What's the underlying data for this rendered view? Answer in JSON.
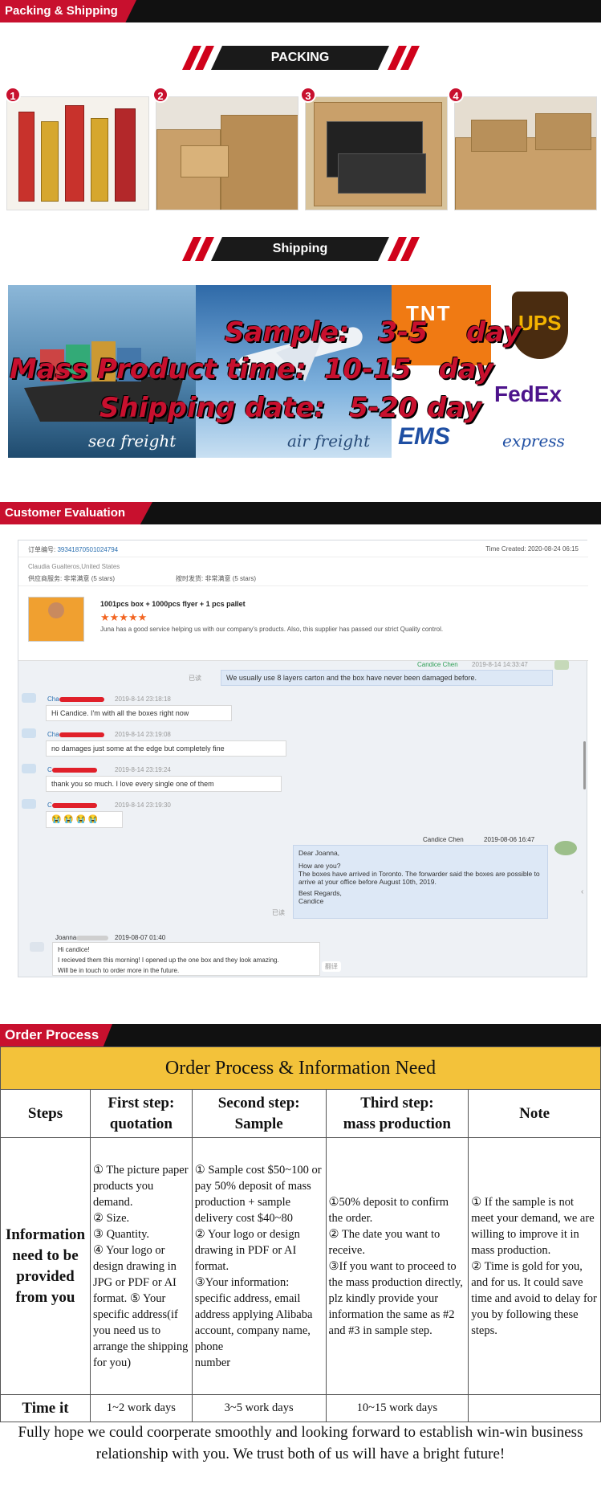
{
  "sections": {
    "packing_shipping": "Packing & Shipping",
    "customer_evaluation": "Customer Evaluation",
    "order_process": "Order Process"
  },
  "packing": {
    "banner": "PACKING",
    "steps": [
      "1",
      "2",
      "3",
      "4"
    ]
  },
  "shipping": {
    "banner": "Shipping",
    "sample_label": "Sample:",
    "sample_value": "3-5",
    "sample_unit": "day",
    "mass_label": "Mass Product time:",
    "mass_value": "10-15",
    "mass_unit": "day",
    "ship_label": "Shipping date:",
    "ship_value": "5-20 day",
    "sea_caption": "sea freight",
    "air_caption": "air freight",
    "express_caption": "express",
    "tnt": "TNT",
    "ups": "UPS",
    "fedex": "FedEx",
    "ems": "EMS"
  },
  "evaluation": {
    "order_no_label": "订单编号:",
    "order_no": "39341870501024794",
    "time_created": "Time Created: 2020-08-24 06:15",
    "customer": "Claudia Gualteros,United States",
    "rating1_label": "供应商服务:",
    "rating1_value": "非常满意",
    "rating1_stars": "(5 stars)",
    "rating2_label": "按时发货:",
    "rating2_value": "非常满意",
    "rating2_stars": "(5 stars)",
    "product": "1001pcs box + 1000pcs flyer + 1 pcs pallet",
    "stars": "★★★★★",
    "review": "Juna has a good service helping us with  our company's products. Also, this supplier has passed our strict Quality control.",
    "chat": [
      {
        "name": "Candice Chen",
        "time": "2019-8-14 14:33:47",
        "text": "We usually use 8 layers carton and the box have never been damaged before.",
        "read": "已读"
      },
      {
        "name": "Cha",
        "time": "2019-8-14 23:18:18",
        "text": "Hi Candice. I'm with all the boxes right now"
      },
      {
        "name": "Cha",
        "time": "2019-8-14 23:19:08",
        "text": "no damages just some at the edge but completely fine"
      },
      {
        "name": "C",
        "time": "2019-8-14 23:19:24",
        "text": "thank you so much. I love every single one of them"
      },
      {
        "name": "C",
        "time": "2019-8-14 23:19:30",
        "text": "😭 😭 😭 😭"
      }
    ],
    "email1": {
      "name": "Candice Chen",
      "time": "2019-08-06 16:47",
      "greeting": "Dear Joanna,",
      "line1": "How are you?",
      "line2": "The boxes have arrived in Toronto. The forwarder said the boxes are possible to arrive at your office before August 10th, 2019.",
      "sign1": "Best Regards,",
      "sign2": "Candice",
      "read": "已读"
    },
    "email2": {
      "name": "Joanna",
      "time": "2019-08-07 01:40",
      "line1": "Hi candice!",
      "line2": "I recieved them this morning! I opened up the one box and they look amazing.",
      "line3": "Will be in touch to order more in the future.",
      "translate": "翻译"
    }
  },
  "order_table": {
    "title": "Order Process & Information Need",
    "headers": [
      "Steps",
      "First step:\nquotation",
      "Second step:\nSample",
      "Third step:\nmass production",
      "Note"
    ],
    "row_label": "Information need to be provided from you",
    "col1": "① The picture paper products you demand.\n② Size.\n③ Quantity.\n④ Your logo or design drawing in JPG or PDF or AI format.             ⑤ Your specific address(if you need us to arrange the shipping for you)",
    "col2": "① Sample cost $50~100 or pay 50% deposit of mass production + sample delivery cost $40~80\n②   Your logo or design drawing in PDF or AI format.\n③Your information: specific address, email address applying Alibaba account, company name, phone\nnumber",
    "col3": "①50% deposit to confirm the   order.\n② The date you want to receive.\n③If you want to proceed to the mass production directly, plz kindly provide your information the same as #2 and #3 in sample step.",
    "col4": "① If the sample is not meet your demand, we are willing to improve it in mass production.\n② Time is gold for you, and for us. It could save time and avoid to delay for you by following these steps.",
    "time_label": "Time it",
    "times": [
      "1~2 work days",
      "3~5 work days",
      "10~15 work days",
      ""
    ]
  },
  "closing": "Fully hope we could coorperate smoothly and looking forward to establish win-win business relationship with you. We trust both of us will have a bright future!",
  "colors": {
    "accent_red": "#c8102e",
    "dark": "#111111",
    "table_header": "#f3c23a"
  }
}
